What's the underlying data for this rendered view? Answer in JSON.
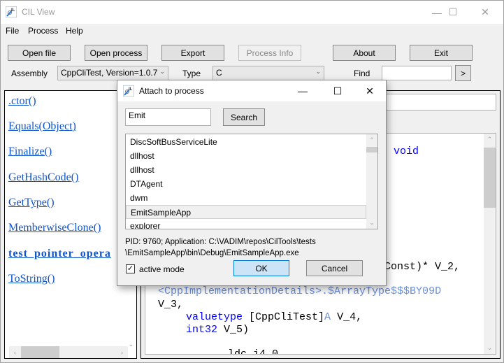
{
  "window": {
    "title": "CIL View",
    "controls": {
      "minimize": "—",
      "maximize": "☐",
      "close": "✕"
    }
  },
  "menu": [
    "File",
    "Process",
    "Help"
  ],
  "toolbar": {
    "buttons": [
      {
        "label": "Open file",
        "enabled": true
      },
      {
        "label": "Open process",
        "enabled": true
      },
      {
        "label": "Export",
        "enabled": true
      },
      {
        "label": "Process Info",
        "enabled": false
      },
      {
        "label": "About",
        "enabled": true
      },
      {
        "label": "Exit",
        "enabled": true
      }
    ],
    "assembly_label": "Assembly",
    "assembly_value": "CppCliTest, Version=1.0.7",
    "type_label": "Type",
    "type_value": "C",
    "find_label": "Find",
    "find_value": "",
    "find_go": ">"
  },
  "methods": [
    {
      "name": ".ctor()",
      "bold": false
    },
    {
      "name": "Equals(Object)",
      "bold": false
    },
    {
      "name": "Finalize()",
      "bold": false
    },
    {
      "name": "GetHashCode()",
      "bold": false
    },
    {
      "name": "GetType()",
      "bold": false
    },
    {
      "name": "MemberwiseClone()",
      "bold": false
    },
    {
      "name": "test_pointer_opera",
      "bold": true
    },
    {
      "name": "ToString()",
      "bold": false
    }
  ],
  "code": {
    "line_void": "void",
    "line_const": "Const)* V_2,",
    "line_arraytype": "<CppImplementationDetails>.$ArrayType$$$BY09D",
    "line_v3": "V_3,",
    "line_valuetype_kw": "valuetype",
    "line_valuetype_rest": " [CppCliTest]",
    "line_valuetype_a": "A",
    "line_valuetype_end": " V_4,",
    "line_int32_kw": "int32",
    "line_int32_rest": " V_5)",
    "line_ldc": "ldc.i4.0"
  },
  "dialog": {
    "title": "Attach to process",
    "search_value": "Emit",
    "search_button": "Search",
    "processes": [
      "DiscSoftBusServiceLite",
      "dllhost",
      "dllhost",
      "DTAgent",
      "dwm",
      "EmitSampleApp",
      "explorer"
    ],
    "selected_index": 5,
    "info_line1": "PID: 9760; Application: C:\\VADIM\\repos\\CilTools\\tests",
    "info_line2": "\\EmitSampleApp\\bin\\Debug\\EmitSampleApp.exe",
    "active_mode_label": "active mode",
    "active_mode_checked": true,
    "ok_label": "OK",
    "cancel_label": "Cancel"
  }
}
